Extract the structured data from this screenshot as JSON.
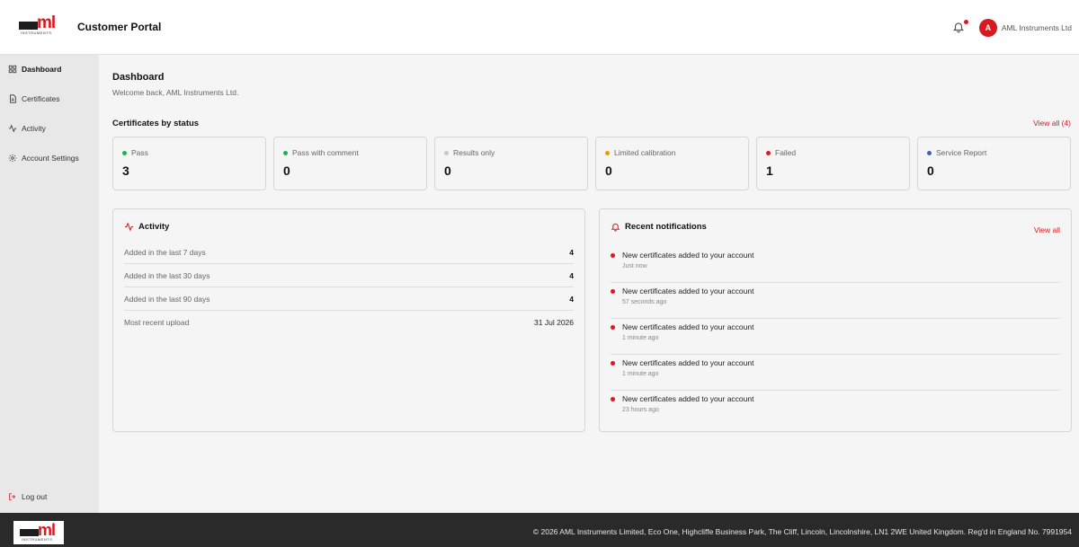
{
  "header": {
    "logo_text": "ml",
    "logo_subtext": "INSTRUMENTS",
    "app_title": "Customer Portal",
    "avatar_initial": "A",
    "user_name": "AML Instruments Ltd"
  },
  "sidebar": {
    "items": [
      {
        "label": "Dashboard",
        "icon": "grid-icon"
      },
      {
        "label": "Certificates",
        "icon": "document-icon"
      },
      {
        "label": "Activity",
        "icon": "activity-icon"
      },
      {
        "label": "Account Settings",
        "icon": "gear-icon"
      }
    ],
    "logout_label": "Log out"
  },
  "main": {
    "title": "Dashboard",
    "welcome": "Welcome back, AML Instruments Ltd.",
    "certificates_heading": "Certificates by status",
    "view_all_label": "View all (4)",
    "statuses": [
      {
        "label": "Pass",
        "count": "3",
        "color": "#22b24c"
      },
      {
        "label": "Pass with comment",
        "count": "0",
        "color": "#22b24c"
      },
      {
        "label": "Results only",
        "count": "0",
        "color": "#c8c8c8"
      },
      {
        "label": "Limited calibration",
        "count": "0",
        "color": "#e0a100"
      },
      {
        "label": "Failed",
        "count": "1",
        "color": "#d71920"
      },
      {
        "label": "Service Report",
        "count": "0",
        "color": "#3a62b0"
      }
    ]
  },
  "activity": {
    "title": "Activity",
    "rows": [
      {
        "label": "Added in the last 7 days",
        "value": "4"
      },
      {
        "label": "Added in the last 30 days",
        "value": "4"
      },
      {
        "label": "Added in the last 90 days",
        "value": "4"
      },
      {
        "label": "Most recent upload",
        "value": "31 Jul 2026"
      }
    ]
  },
  "notifications": {
    "title": "Recent notifications",
    "view_all_label": "View all",
    "items": [
      {
        "message": "New certificates added to your account",
        "time": "Just now"
      },
      {
        "message": "New certificates added to your account",
        "time": "57 seconds ago"
      },
      {
        "message": "New certificates added to your account",
        "time": "1 minute ago"
      },
      {
        "message": "New certificates added to your account",
        "time": "1 minute ago"
      },
      {
        "message": "New certificates added to your account",
        "time": "23 hours ago"
      }
    ]
  },
  "footer": {
    "logo_text": "ml",
    "logo_subtext": "INSTRUMENTS",
    "copyright": "© 2026 AML Instruments Limited, Eco One, Highcliffe Business Park, The Cliff, Lincoln, Lincolnshire, LN1 2WE United Kingdom. Reg'd in England No. 7991954"
  },
  "colors": {
    "accent": "#d71920",
    "sidebar_bg": "#e8e8e8",
    "footer_bg": "#2a2a2a"
  }
}
